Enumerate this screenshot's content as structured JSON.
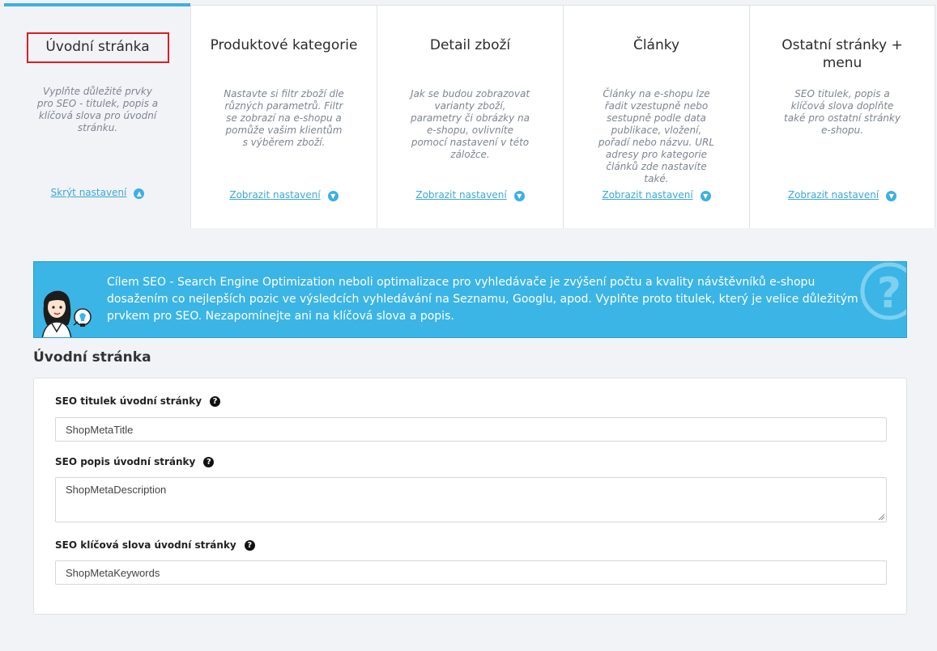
{
  "tabs": [
    {
      "title": "Úvodní stránka",
      "description": "Vyplňte důležité prvky pro SEO - titulek, popis a klíčová slova pro úvodní stránku.",
      "link": "Skrýt nastavení",
      "link_icon": "chevron-up-icon",
      "active": true
    },
    {
      "title": "Produktové kategorie",
      "description": "Nastavte si filtr zboží dle různých parametrů. Filtr se zobrazí na e-shopu a pomůže vašim klientům s výběrem zboží.",
      "link": "Zobrazit nastavení",
      "link_icon": "chevron-down-icon"
    },
    {
      "title": "Detail zboží",
      "description": "Jak se budou zobrazovat varianty zboží, parametry či obrázky na e-shopu, ovlivníte pomocí nastavení v této záložce.",
      "link": "Zobrazit nastavení",
      "link_icon": "chevron-down-icon"
    },
    {
      "title": "Články",
      "description": "Články na e-shopu lze řadit vzestupně nebo sestupně podle data publikace, vložení, pořadí nebo názvu. URL adresy pro kategorie článků zde nastavíte také.",
      "link": "Zobrazit nastavení",
      "link_icon": "chevron-down-icon"
    },
    {
      "title": "Ostatní stránky + menu",
      "description": "SEO titulek, popis a klíčová slova doplňte také pro ostatní stránky e-shopu.",
      "link": "Zobrazit nastavení",
      "link_icon": "chevron-down-icon"
    }
  ],
  "banner": {
    "text": "Cílem SEO - Search Engine Optimization neboli optimalizace pro vyhledávače je zvýšení počtu a kvality návštěvníků e-shopu dosažením co nejlepších pozic ve výsledcích vyhledávání na Seznamu, Googlu, apod. Vyplňte proto titulek, který je velice důležitým prvkem pro SEO. Nezapomínejte ani na klíčová slova a popis.",
    "illustration_icon": "assistant-girl-icon",
    "decor_icon": "question-mark-icon"
  },
  "section": {
    "title": "Úvodní stránka",
    "fields": {
      "title": {
        "label": "SEO titulek úvodní stránky",
        "value": "ShopMetaTitle"
      },
      "description": {
        "label": "SEO popis úvodní stránky",
        "value": "ShopMetaDescription"
      },
      "keywords": {
        "label": "SEO klíčová slova úvodní stránky",
        "value": "ShopMetaKeywords"
      }
    },
    "help_icon": "question-circle-icon"
  },
  "colors": {
    "accent": "#3bb5e6",
    "highlight_border": "#e01b22",
    "background": "#f2f3f7"
  }
}
